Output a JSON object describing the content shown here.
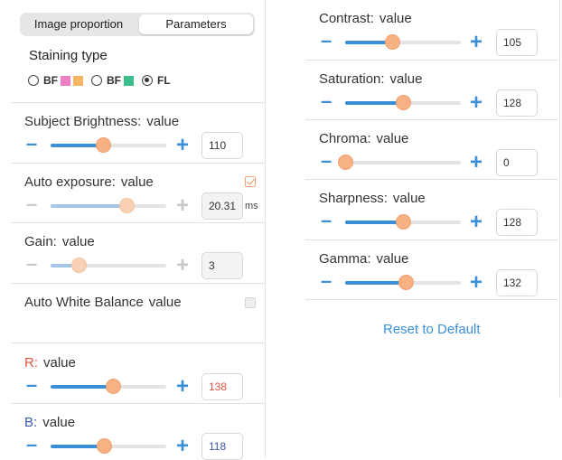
{
  "tabs": {
    "image_proportion": "Image proportion",
    "parameters": "Parameters"
  },
  "staining": {
    "label": "Staining type",
    "options": [
      {
        "label": "BF",
        "checked": false,
        "colors": [
          "#ee7fc4",
          "#f5b563"
        ]
      },
      {
        "label": "BF",
        "checked": false,
        "colors": [
          "#3cbf8d"
        ]
      },
      {
        "label": "FL",
        "checked": true,
        "colors": []
      }
    ]
  },
  "value_word": "value",
  "left_params": [
    {
      "key": "brightness",
      "label": "Subject Brightness:",
      "value": "110",
      "fraction": 0.45,
      "enabled": true
    },
    {
      "key": "exposure",
      "label": "Auto exposure:",
      "value": "20.31",
      "unit": "ms",
      "fraction": 0.66,
      "enabled": false,
      "auto_checked": true
    },
    {
      "key": "gain",
      "label": "Gain:",
      "value": "3",
      "fraction": 0.24,
      "enabled": false
    },
    {
      "key": "r",
      "label": "R:",
      "value": "138",
      "fraction": 0.54,
      "enabled": true,
      "label_color": "#e0533f"
    },
    {
      "key": "b",
      "label": "B:",
      "value": "118",
      "fraction": 0.46,
      "enabled": true,
      "label_color": "#3e57a8"
    }
  ],
  "white_balance": {
    "label": "Auto White Balance",
    "checked": false
  },
  "right_params": [
    {
      "key": "contrast",
      "label": "Contrast:",
      "value": "105",
      "fraction": 0.41
    },
    {
      "key": "saturation",
      "label": "Saturation:",
      "value": "128",
      "fraction": 0.5
    },
    {
      "key": "chroma",
      "label": "Chroma:",
      "value": "0",
      "fraction": 0.0
    },
    {
      "key": "sharpness",
      "label": "Sharpness:",
      "value": "128",
      "fraction": 0.5
    },
    {
      "key": "gamma",
      "label": "Gamma:",
      "value": "132",
      "fraction": 0.52
    }
  ],
  "reset_label": "Reset to Default",
  "colors": {
    "accent": "#3b8fd8",
    "thumb": "#f7b183",
    "r_label": "#e0533f",
    "b_label": "#3e57a8"
  }
}
